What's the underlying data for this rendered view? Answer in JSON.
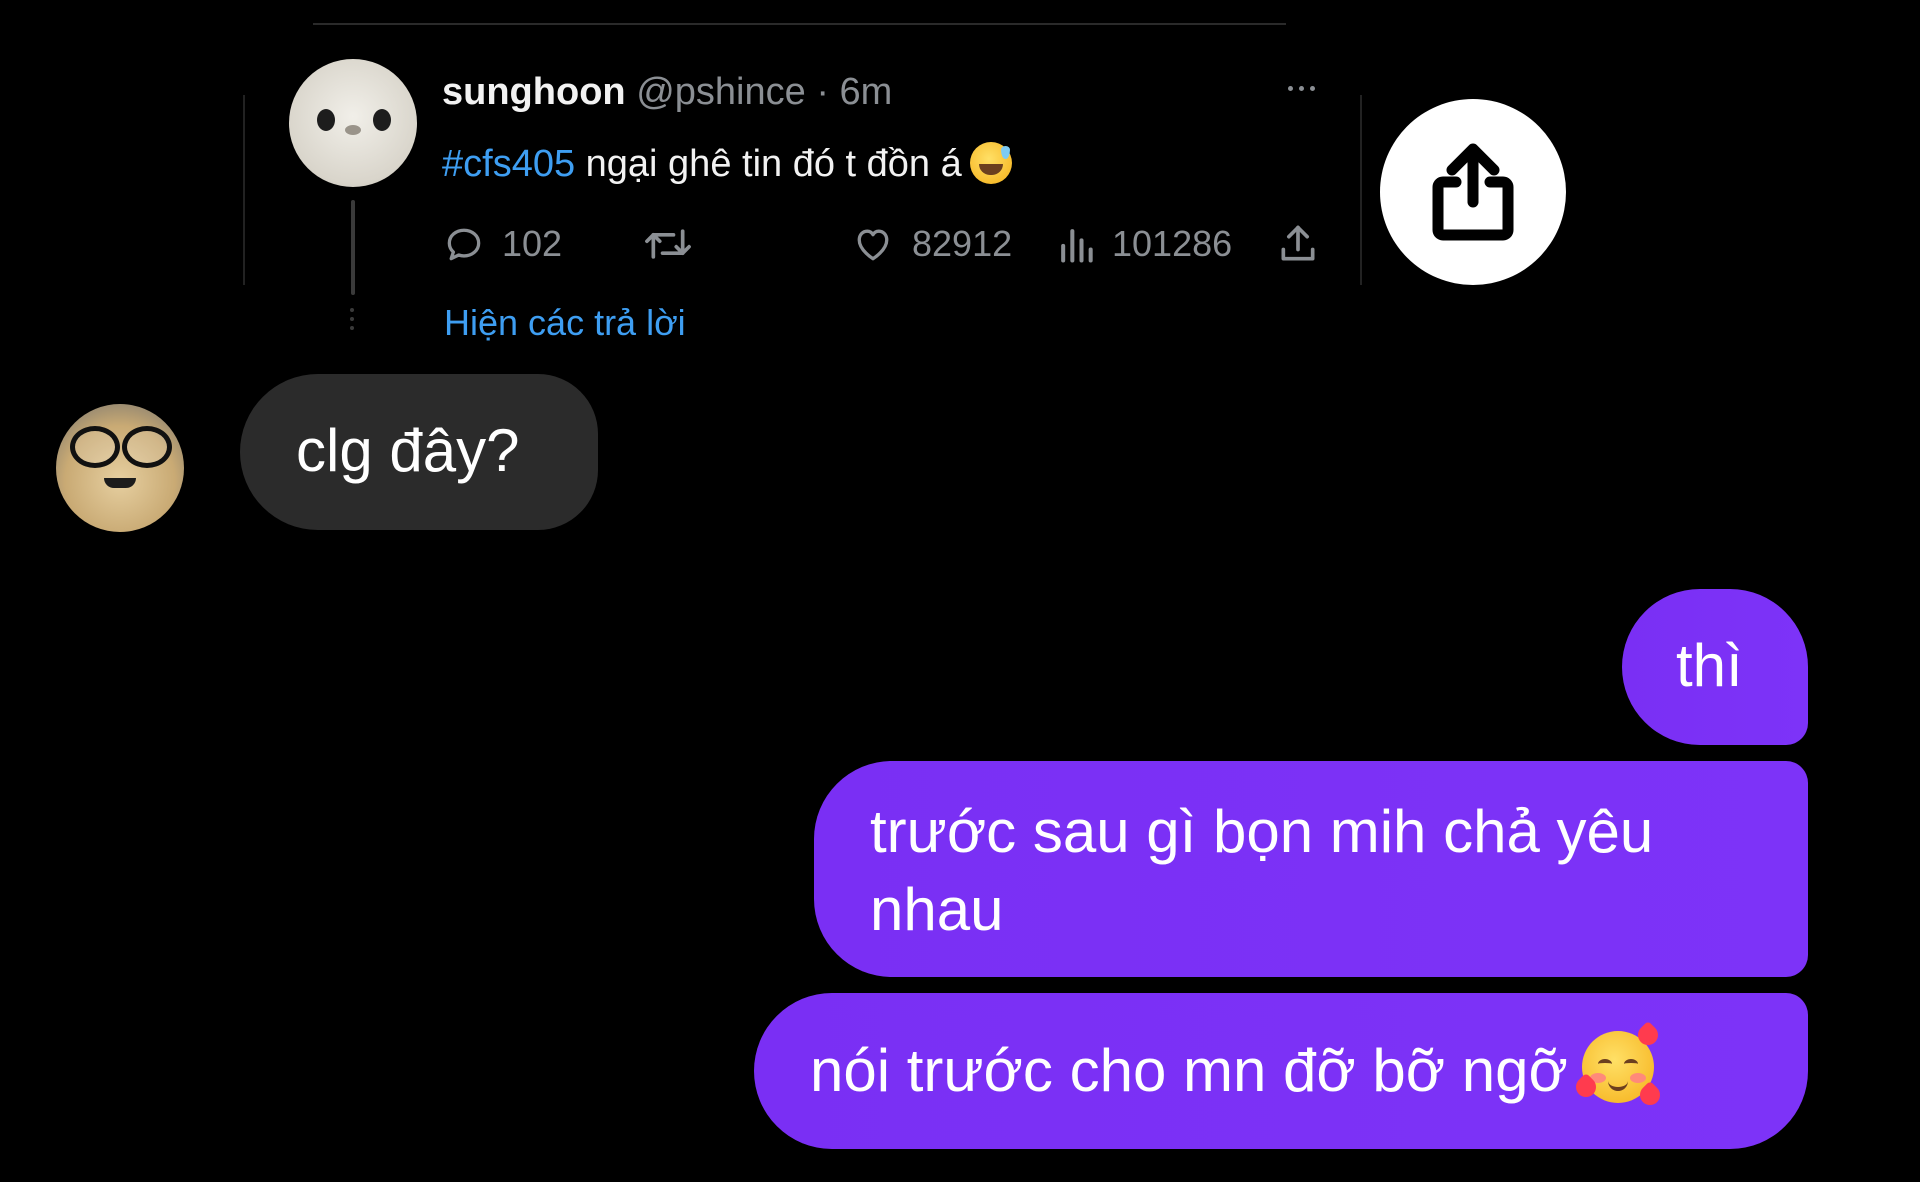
{
  "tweet": {
    "author_name": "sunghoon",
    "handle": "@pshince",
    "separator": "·",
    "time": "6m",
    "hashtag": "#cfs405",
    "text": " ngại ghê tin đó t đồn á",
    "emoji": "sweat-smile-emoji",
    "replies": "102",
    "retweets": "",
    "likes": "82912",
    "views": "101286",
    "show_replies_label": "Hiện các trả lời"
  },
  "messages": {
    "incoming": [
      {
        "text": "clg đây?"
      }
    ],
    "outgoing": [
      {
        "text": "thì"
      },
      {
        "text": "trước sau gì bọn mih chả yêu nhau"
      },
      {
        "text": "nói trước cho mn đỡ bỡ ngỡ",
        "emoji": "smiling-face-with-hearts-emoji"
      }
    ]
  },
  "colors": {
    "background": "#000000",
    "incoming_bubble": "#2b2b2b",
    "outgoing_bubble": "#7b2ff7",
    "link_blue": "#3e9ef2",
    "muted_text": "#8b8f94"
  },
  "icons": {
    "reply": "comment-icon",
    "retweet": "retweet-icon",
    "like": "heart-icon",
    "views": "bar-chart-icon",
    "share": "upload-icon",
    "share_fab": "share-icon",
    "more": "more-horizontal-icon"
  }
}
